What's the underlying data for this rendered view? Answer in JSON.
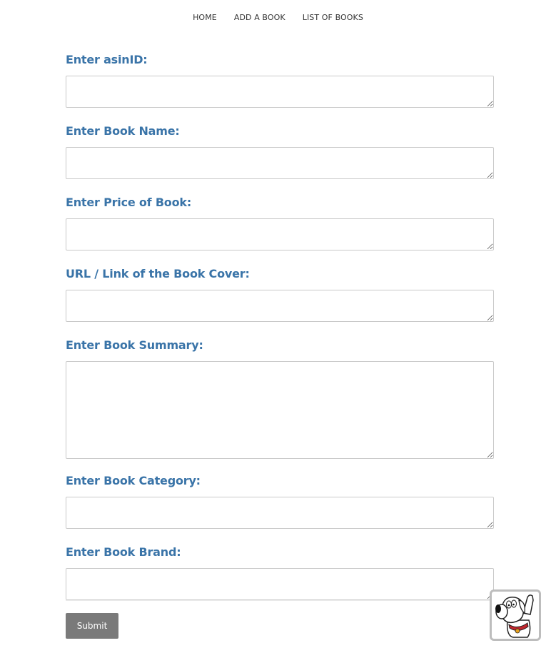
{
  "nav": {
    "items": [
      {
        "label": "HOME"
      },
      {
        "label": "ADD A BOOK"
      },
      {
        "label": "LIST OF BOOKS"
      }
    ]
  },
  "form": {
    "fields": [
      {
        "label": "Enter asinID:",
        "value": ""
      },
      {
        "label": "Enter Book Name:",
        "value": ""
      },
      {
        "label": "Enter Price of Book:",
        "value": ""
      },
      {
        "label": "URL / Link of the Book Cover:",
        "value": ""
      },
      {
        "label": "Enter Book Summary:",
        "value": ""
      },
      {
        "label": "Enter Book Category:",
        "value": ""
      },
      {
        "label": "Enter Book Brand:",
        "value": ""
      }
    ],
    "submit_label": "Submit"
  },
  "mascot": {
    "icon": "cartoon-dog-icon"
  },
  "colors": {
    "label": "#3a74a8",
    "submit_bg": "#7a7a7a",
    "nav_text": "#333333"
  }
}
